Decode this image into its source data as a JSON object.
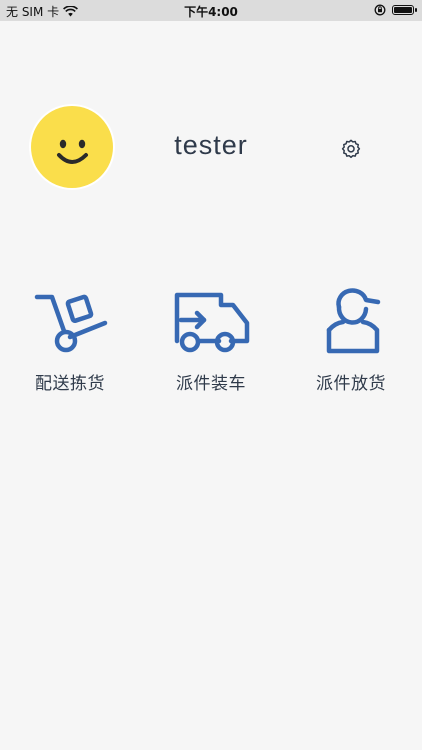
{
  "status_bar": {
    "carrier": "无 SIM 卡",
    "time": "下午4:00"
  },
  "profile": {
    "username": "tester"
  },
  "menu": [
    {
      "label": "配送拣货",
      "icon": "cart-icon"
    },
    {
      "label": "派件装车",
      "icon": "truck-icon"
    },
    {
      "label": "派件放货",
      "icon": "courier-icon"
    }
  ],
  "colors": {
    "accent": "#3769b3",
    "avatar": "#fade4b",
    "background": "#f6f6f6"
  }
}
